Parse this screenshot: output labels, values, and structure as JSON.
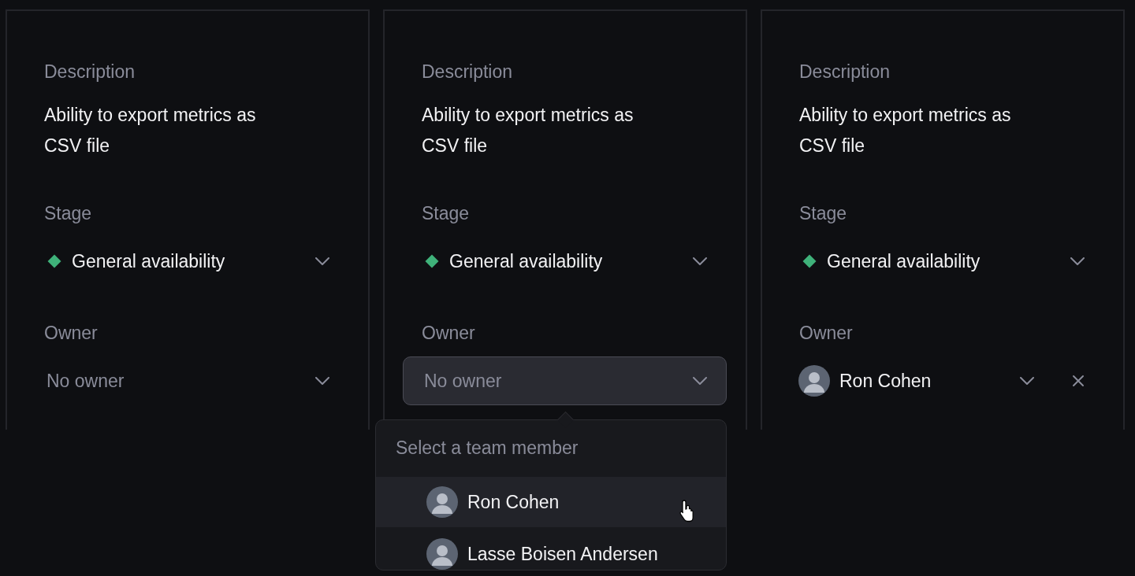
{
  "panels": [
    {
      "description_label": "Description",
      "description": "Ability to export metrics as CSV file",
      "stage_label": "Stage",
      "stage": {
        "text": "General availability",
        "color": "#3fb27a"
      },
      "owner_label": "Owner",
      "owner": {
        "kind": "none",
        "text": "No owner",
        "open": false,
        "clearable": false
      }
    },
    {
      "description_label": "Description",
      "description": "Ability to export metrics as CSV file",
      "stage_label": "Stage",
      "stage": {
        "text": "General availability",
        "color": "#3fb27a"
      },
      "owner_label": "Owner",
      "owner": {
        "kind": "none",
        "text": "No owner",
        "open": true,
        "clearable": false
      },
      "dropdown": {
        "title": "Select a team member",
        "members": [
          {
            "name": "Ron Cohen",
            "highlighted": true
          },
          {
            "name": "Lasse Boisen Andersen",
            "highlighted": false
          }
        ]
      }
    },
    {
      "description_label": "Description",
      "description": "Ability to export metrics as CSV file",
      "stage_label": "Stage",
      "stage": {
        "text": "General availability",
        "color": "#3fb27a"
      },
      "owner_label": "Owner",
      "owner": {
        "kind": "person",
        "text": "Ron Cohen",
        "open": false,
        "clearable": true
      }
    }
  ]
}
